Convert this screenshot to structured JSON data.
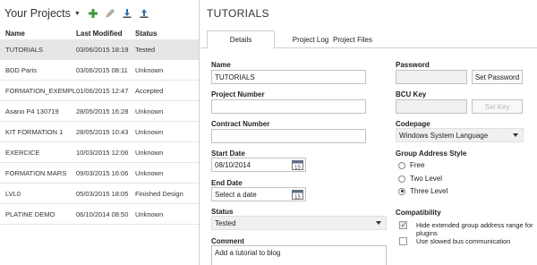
{
  "left_panel": {
    "title": "Your Projects",
    "toolbar": {
      "new_icon": "plus-icon",
      "edit_icon": "pencil-icon",
      "import_icon": "import-icon",
      "export_icon": "export-icon"
    },
    "columns": [
      "Name",
      "Last Modified",
      "Status"
    ],
    "rows": [
      {
        "name": "TUTORIALS",
        "modified": "03/06/2015 18:19",
        "status": "Tested"
      },
      {
        "name": "BDD Paris",
        "modified": "03/06/2015 08:11",
        "status": "Unknown"
      },
      {
        "name": "FORMATION_EXEMPLE",
        "modified": "01/06/2015 12:47",
        "status": "Accepted"
      },
      {
        "name": "Asano P4 130719",
        "modified": "28/05/2015 16:28",
        "status": "Unknown"
      },
      {
        "name": "KIT FORMATION 1",
        "modified": "28/05/2015 10:43",
        "status": "Unknown"
      },
      {
        "name": "EXERCICE",
        "modified": "10/03/2015 12:06",
        "status": "Unknown"
      },
      {
        "name": "FORMATION MARS",
        "modified": "09/03/2015 16:06",
        "status": "Unknown"
      },
      {
        "name": "LVL0",
        "modified": "05/03/2015 18:05",
        "status": "Finished Design"
      },
      {
        "name": "PLATINE DEMO",
        "modified": "06/10/2014 08:50",
        "status": "Unknown"
      }
    ]
  },
  "right_panel": {
    "title": "TUTORIALS",
    "tabs": [
      "Details",
      "Project Log",
      "Project Files"
    ],
    "name_label": "Name",
    "name_value": "TUTORIALS",
    "project_number_label": "Project Number",
    "project_number_value": "",
    "contract_number_label": "Contract Number",
    "contract_number_value": "",
    "start_date_label": "Start Date",
    "start_date_value": "08/10/2014",
    "end_date_label": "End Date",
    "end_date_placeholder": "Select a date",
    "status_label": "Status",
    "status_value": "Tested",
    "comment_label": "Comment",
    "comment_value": "Add a tutorial to blog",
    "password_label": "Password",
    "set_password_button": "Set Password",
    "bcu_key_label": "BCU Key",
    "set_key_button": "Set Key",
    "codepage_label": "Codepage",
    "codepage_value": "Windows System Language",
    "group_address_label": "Group Address Style",
    "radio_options": [
      "Free",
      "Two Level",
      "Three Level"
    ],
    "radio_selected": "Three Level",
    "compatibility_label": "Compatibility",
    "compat_option_1": "Hide extended group address range for plugins",
    "compat_option_1_checked": true,
    "compat_option_2": "Use slowed bus communication",
    "compat_option_2_checked": false
  },
  "colors": {
    "selected_row": "#e6e6e6",
    "plus_icon": "#3a9a3a",
    "import_export_icon": "#2d6fa8"
  }
}
